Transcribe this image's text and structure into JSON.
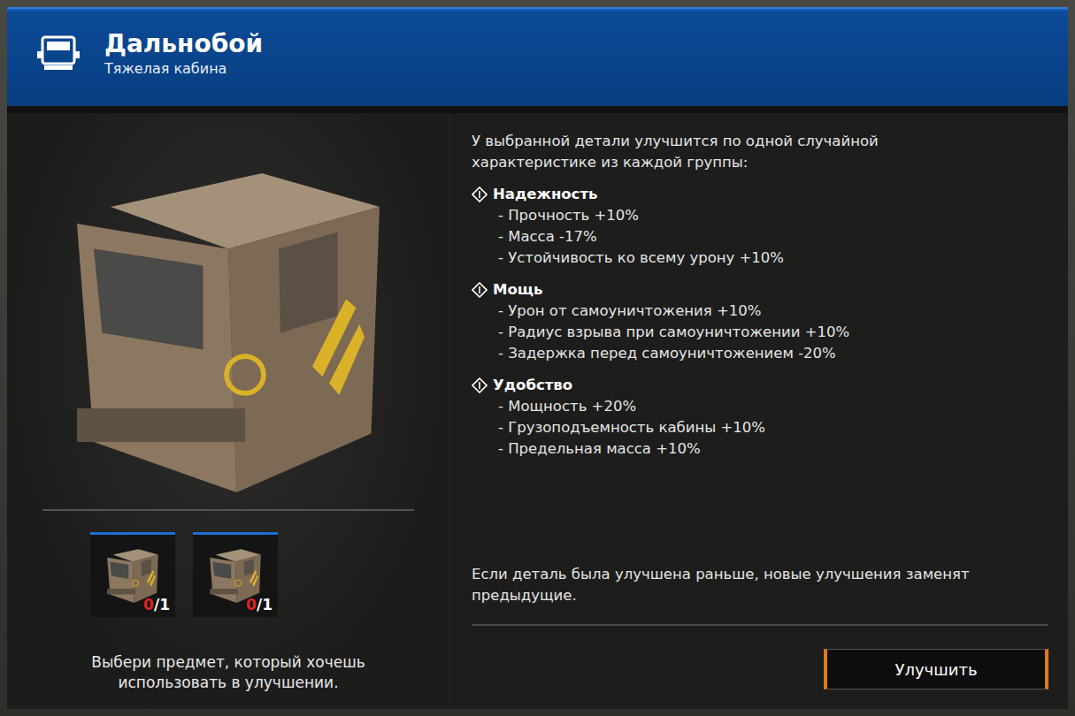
{
  "header": {
    "title": "Дальнобой",
    "subtitle": "Тяжелая кабина"
  },
  "preview": {
    "slots": [
      {
        "count": "0",
        "limit": "/1"
      },
      {
        "count": "0",
        "limit": "/1"
      }
    ],
    "hint": "Выбери предмет, который хочешь использовать в улучшении."
  },
  "info": {
    "intro": "У выбранной детали улучшится по одной случайной характеристике из каждой группы:",
    "groups": [
      {
        "name": "Надежность",
        "items": [
          "- Прочность +10%",
          "- Масса -17%",
          "- Устойчивость ко всему урону +10%"
        ]
      },
      {
        "name": "Мощь",
        "items": [
          "- Урон от самоуничтожения +10%",
          "- Радиус взрыва при самоуничтожении +10%",
          "- Задержка перед самоуничтожением -20%"
        ]
      },
      {
        "name": "Удобство",
        "items": [
          "- Мощность +20%",
          "- Грузоподъемность кабины +10%",
          "- Предельная масса +10%"
        ]
      }
    ],
    "note": "Если деталь была улучшена раньше, новые улучшения заменят предыдущие."
  },
  "buttons": [
    "Улучшить"
  ]
}
